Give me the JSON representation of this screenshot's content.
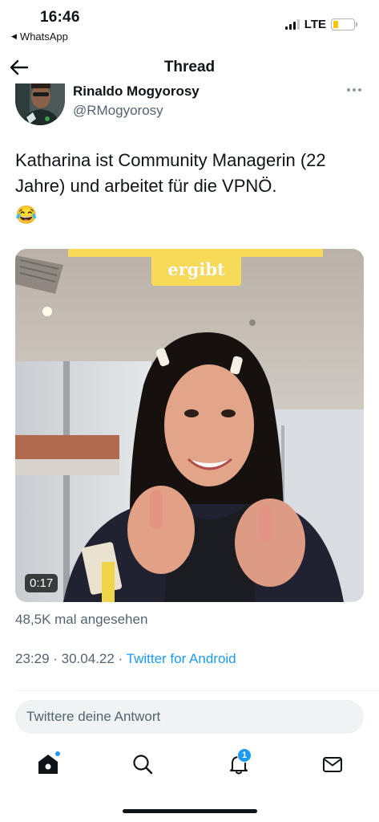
{
  "status_bar": {
    "time": "16:46",
    "back_app": "WhatsApp",
    "network": "LTE",
    "battery_color": "#f7c500"
  },
  "header": {
    "title": "Thread",
    "back_icon": "arrow-left-icon"
  },
  "author": {
    "name": "Rinaldo Mogyorosy",
    "handle": "@RMogyorosy",
    "more_icon": "more-horizontal-icon"
  },
  "tweet": {
    "text": "Katharina ist Community Managerin (22 Jahre) und arbeitet für die VPNÖ.",
    "emoji": "😂"
  },
  "media": {
    "caption": "ergibt",
    "duration": "0:17"
  },
  "meta": {
    "views": "48,5K mal angesehen",
    "timestamp": "23:29 · 30.04.22 · ",
    "source": "Twitter for Android"
  },
  "reply": {
    "placeholder": "Twittere deine Antwort"
  },
  "bottom_nav": {
    "items": [
      {
        "icon": "home-icon",
        "active": true
      },
      {
        "icon": "search-icon"
      },
      {
        "icon": "bell-icon",
        "badge": "1"
      },
      {
        "icon": "mail-icon"
      }
    ]
  },
  "colors": {
    "accent": "#1d9bf0",
    "secondary_text": "#536471",
    "caption_bg": "#f7da57"
  }
}
